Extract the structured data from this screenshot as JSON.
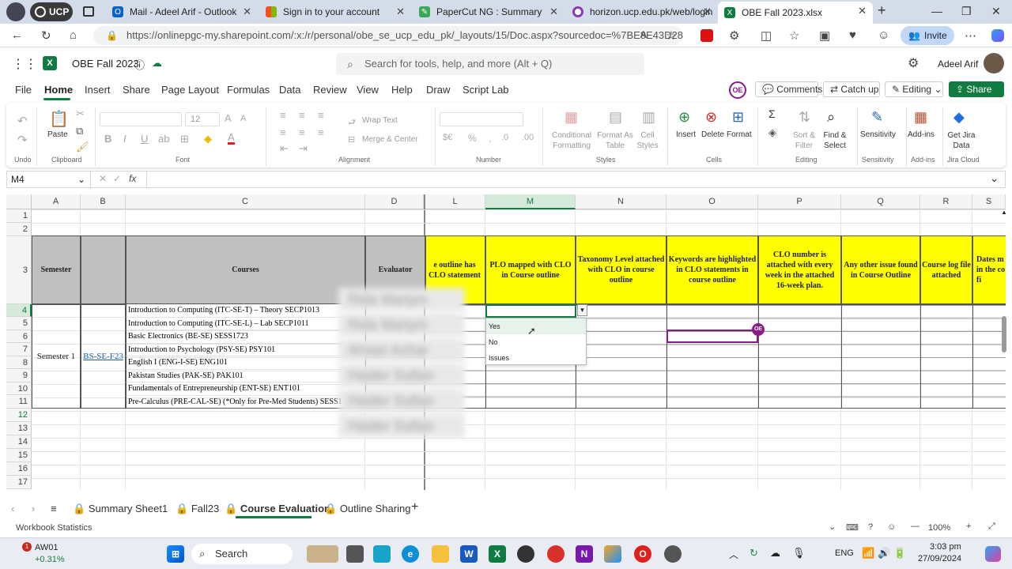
{
  "browser": {
    "profile_label": "UCP",
    "tabs": [
      {
        "label": "Mail - Adeel Arif - Outlook",
        "color": "#0a64c8"
      },
      {
        "label": "Sign in to your account",
        "color": "#f25022"
      },
      {
        "label": "PaperCut NG : Summary",
        "color": "#3aa857"
      },
      {
        "label": "horizon.ucp.edu.pk/web/login",
        "color": "#8a3ab9"
      },
      {
        "label": "OBE Fall 2023.xlsx",
        "color": "#107c41"
      }
    ],
    "url": "https://onlinepgc-my.sharepoint.com/:x:/r/personal/obe_se_ucp_edu_pk/_layouts/15/Doc.aspx?sourcedoc=%7BE8E43D28...",
    "invite_label": "Invite"
  },
  "excel": {
    "file_title": "OBE Fall 2023",
    "search_placeholder": "Search for tools, help, and more (Alt + Q)",
    "user_name": "Adeel Arif",
    "menu": [
      "File",
      "Home",
      "Insert",
      "Share",
      "Page Layout",
      "Formulas",
      "Data",
      "Review",
      "View",
      "Help",
      "Draw",
      "Script Lab"
    ],
    "avatar_initials": "OE",
    "comments_label": "Comments",
    "catchup_label": "Catch up",
    "editing_label": "Editing",
    "share_label": "Share",
    "accent": "#107c41"
  },
  "ribbon": {
    "undo": "Undo",
    "paste": "Paste",
    "clipboard": "Clipboard",
    "font": "Font",
    "font_size": "12",
    "wrap_text": "Wrap Text",
    "merge_center": "Merge & Center",
    "alignment": "Alignment",
    "number": "Number",
    "conditional": "Conditional Formatting",
    "format_as_table": "Format As Table",
    "cell_styles": "Cell Styles",
    "styles": "Styles",
    "insert": "Insert",
    "delete": "Delete",
    "format": "Format",
    "cells": "Cells",
    "sort_filter": "Sort & Filter",
    "find_select": "Find & Select",
    "editing": "Editing",
    "sensitivity": "Sensitivity",
    "sensitivity_group": "Sensitivity",
    "addins": "Add-ins",
    "addins_group": "Add-ins",
    "jira": "Get Jira Data",
    "jira_group": "Jira Cloud"
  },
  "formula_bar": {
    "name_box": "M4",
    "formula": ""
  },
  "sheet": {
    "columns": [
      "A",
      "B",
      "C",
      "D",
      "L",
      "M",
      "N",
      "O",
      "P",
      "Q",
      "R",
      "S"
    ],
    "rows": [
      "1",
      "2",
      "3",
      "4",
      "5",
      "6",
      "7",
      "8",
      "9",
      "10",
      "11",
      "12",
      "13",
      "14",
      "15",
      "16",
      "17"
    ],
    "headers": {
      "semester": "Semester",
      "courses": "Courses",
      "evaluator": "Evaluator",
      "L": "e outline has CLO statement",
      "M": "PLO mapped with CLO in Course outline",
      "N": "Taxonomy Level attached with CLO in course outline",
      "O": "Keywords are highlighted in CLO statements in course outline",
      "P": "CLO number is attached with every week in the attached 16-week plan.",
      "Q": "Any other issue found in Course Outline",
      "R": "Course log file attached",
      "S": "Dates m in the co fi"
    },
    "semester_value": "Semester 1",
    "program_value": "BS-SE-F23",
    "courses": [
      "Introduction  to  Computing (ITC-SE-T) – Theory SECP1013",
      "Introduction  to Computing (ITC-SE-L) – Lab SECP1011",
      "Basic Electronics (BE-SE) SESS1723",
      "Introduction to Psychology  (PSY-SE) PSY101",
      "English I (ENG-I-SE) ENG101",
      "Pakistan Studies  (PAK-SE) PAK101",
      "Fundamentals of Entrepreneurship (ENT-SE) ENT101",
      "Pre-Calculus (PRE-CAL-SE) (*Only for Pre-Med Students) SESS1"
    ],
    "evaluators": [
      "Rida Mariym",
      "Rida Mariym",
      "Ahsan Azhar",
      "Haider Sultan",
      "Haider Sultan",
      "Haider Sultan"
    ],
    "dropdown_options": [
      "Yes",
      "No",
      "Issues"
    ],
    "header_fill": "#ffff00",
    "grey_fill": "#c0c0c0"
  },
  "sheet_tabs": [
    "Summary",
    "Sheet1",
    "Fall23",
    "Course Evaluation",
    "Outline Sharing"
  ],
  "active_sheet": "Course Evaluation",
  "status": {
    "workbook_stats": "Workbook Statistics",
    "zoom": "100%"
  },
  "taskbar": {
    "stock_name": "AW01",
    "stock_change": "+0.31%",
    "stock_badge": "1",
    "search_label": "Search",
    "lang": "ENG",
    "time": "3:03 pm",
    "date": "27/09/2024"
  }
}
